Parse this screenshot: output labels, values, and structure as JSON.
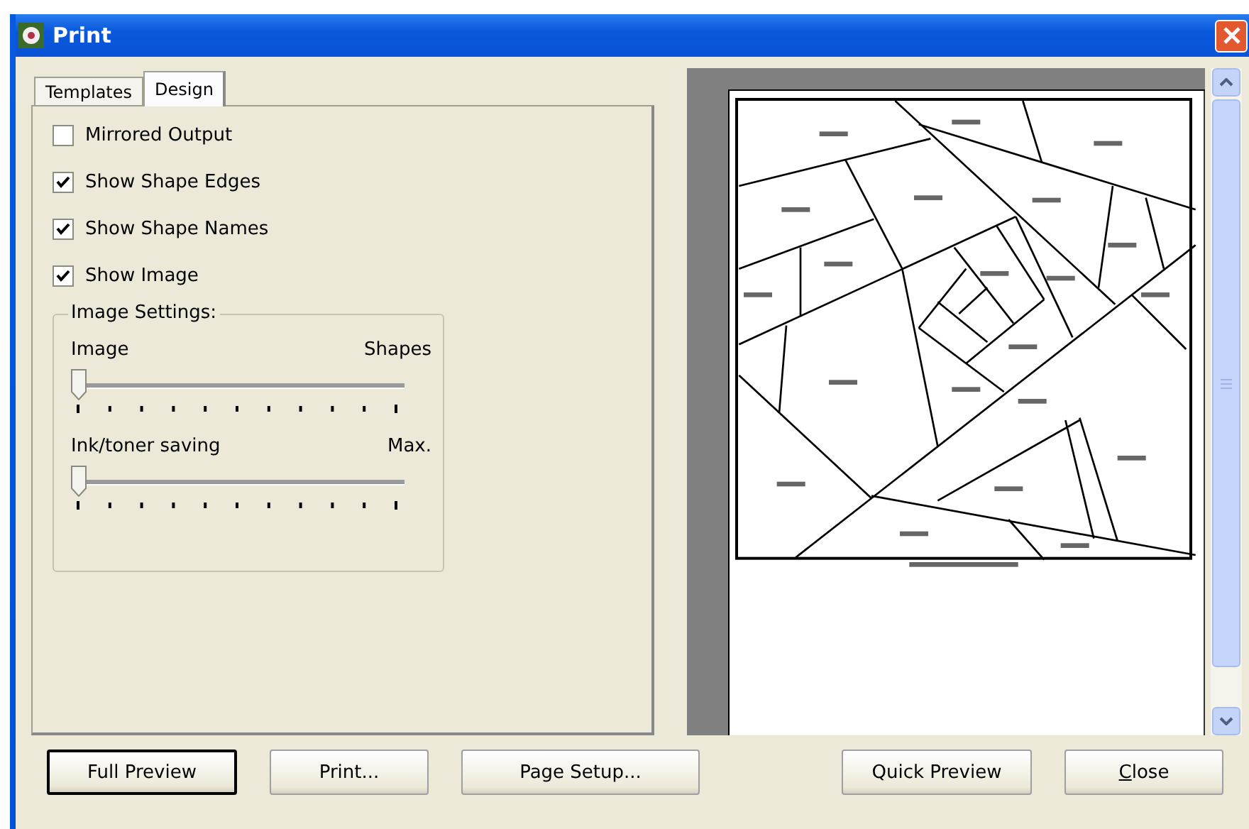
{
  "window": {
    "title": "Print"
  },
  "tabs": [
    {
      "label": "Templates",
      "selected": false
    },
    {
      "label": "Design",
      "selected": true
    }
  ],
  "options": [
    {
      "label": "Mirrored Output",
      "checked": false
    },
    {
      "label": "Show Shape Edges",
      "checked": true
    },
    {
      "label": "Show Shape Names",
      "checked": true
    },
    {
      "label": "Show Image",
      "checked": true
    }
  ],
  "image_settings": {
    "title": "Image Settings:",
    "sliders": [
      {
        "left_label": "Image",
        "right_label": "Shapes",
        "level": 0
      },
      {
        "left_label": "Ink/toner saving",
        "right_label": "Max.",
        "level": 0
      }
    ]
  },
  "buttons": [
    {
      "label": "Full Preview",
      "default": true
    },
    {
      "label": "Print...",
      "default": false
    },
    {
      "label": "Page Setup...",
      "default": false
    },
    {
      "label": "Quick Preview",
      "default": false
    },
    {
      "label": "Close",
      "default": false
    }
  ]
}
